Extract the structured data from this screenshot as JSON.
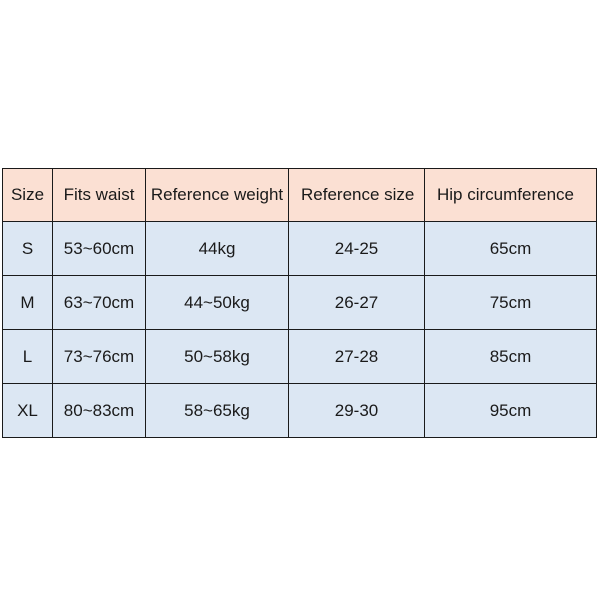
{
  "table": {
    "name": "size-chart",
    "colors": {
      "header_background": "#fbe0d3",
      "body_background": "#dce7f3",
      "border": "#1a1a1a",
      "text": "#1a1a1a",
      "page_background": "#ffffff"
    },
    "headers": [
      "Size",
      "Fits waist",
      "Reference weight",
      "Reference size",
      "Hip circumference"
    ],
    "rows": [
      {
        "size": "S",
        "fits_waist": "53~60cm",
        "reference_weight": "44kg",
        "reference_size": "24-25",
        "hip_circumference": "65cm"
      },
      {
        "size": "M",
        "fits_waist": "63~70cm",
        "reference_weight": "44~50kg",
        "reference_size": "26-27",
        "hip_circumference": "75cm"
      },
      {
        "size": "L",
        "fits_waist": "73~76cm",
        "reference_weight": "50~58kg",
        "reference_size": "27-28",
        "hip_circumference": "85cm"
      },
      {
        "size": "XL",
        "fits_waist": "80~83cm",
        "reference_weight": "58~65kg",
        "reference_size": "29-30",
        "hip_circumference": "95cm"
      }
    ]
  }
}
